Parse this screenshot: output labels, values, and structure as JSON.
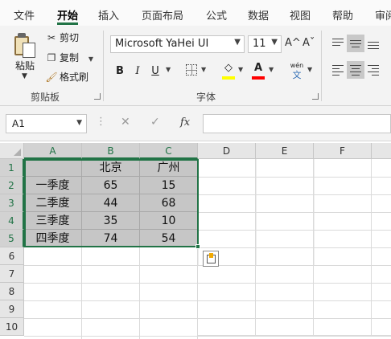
{
  "menu": {
    "tabs": [
      "文件",
      "开始",
      "插入",
      "页面布局",
      "公式",
      "数据",
      "视图",
      "帮助",
      "审阅"
    ],
    "active": "开始"
  },
  "clipboard": {
    "paste_label": "粘贴",
    "cut_label": "剪切",
    "copy_label": "复制",
    "format_painter_label": "格式刷",
    "group_label": "剪贴板"
  },
  "font": {
    "name": "Microsoft YaHei UI",
    "size": "11",
    "grow_label": "A^",
    "shrink_label": "Aˇ",
    "bold_label": "B",
    "italic_label": "I",
    "underline_label": "U",
    "phonetic_label": "wén",
    "phonetic_sub": "文",
    "fill_color": "#ffff00",
    "font_color": "#ff0000",
    "group_label": "字体"
  },
  "formula_bar": {
    "name_box": "A1",
    "fx_label": "fx",
    "cancel_label": "✕",
    "enter_label": "✓",
    "value": ""
  },
  "sheet": {
    "columns": [
      "A",
      "B",
      "C",
      "D",
      "E",
      "F"
    ],
    "rows": [
      "1",
      "2",
      "3",
      "4",
      "5",
      "6",
      "7",
      "8",
      "9",
      "10"
    ],
    "data": [
      [
        "",
        "北京",
        "广州"
      ],
      [
        "一季度",
        "65",
        "15"
      ],
      [
        "二季度",
        "44",
        "68"
      ],
      [
        "三季度",
        "35",
        "10"
      ],
      [
        "四季度",
        "74",
        "54"
      ]
    ],
    "selection": "A1:C5",
    "accent_color": "#217346"
  }
}
